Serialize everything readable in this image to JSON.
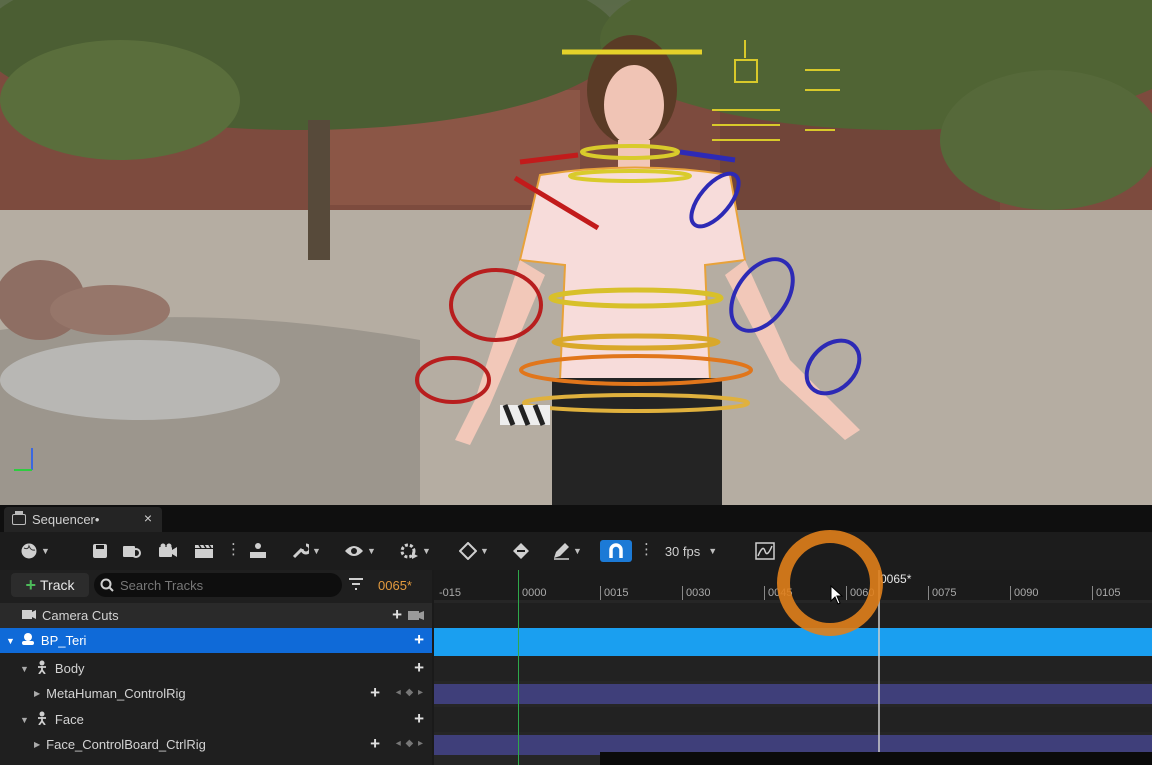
{
  "sequencer": {
    "tab_title": "Sequencer•",
    "close_glyph": "×",
    "toolbar": {
      "fps_label": "30 fps",
      "snap_active_color": "#1c7ad6"
    },
    "track_button_label": "Track",
    "search_placeholder": "Search Tracks",
    "current_frame": "0065*",
    "tracks": [
      {
        "label": "Camera Cuts",
        "icon": "camera-cuts-icon"
      },
      {
        "label": "BP_Teri",
        "icon": "actor-icon",
        "selected": true
      },
      {
        "label": "Body",
        "icon": "skeleton-icon"
      },
      {
        "label": "MetaHuman_ControlRig",
        "icon": "control-rig-icon"
      },
      {
        "label": "Face",
        "icon": "skeleton-icon"
      },
      {
        "label": "Face_ControlBoard_CtrlRig",
        "icon": "control-rig-icon"
      }
    ],
    "ruler_ticks": [
      "-015",
      "0000",
      "0015",
      "0030",
      "0045",
      "0060",
      "0075",
      "0090",
      "0105"
    ],
    "playhead_label": "0065*"
  },
  "colors": {
    "selection": "#0f6ad8",
    "section_blue": "#1a9ff0",
    "section_rig": "#3f3f7a",
    "highlight_ring": "#e0801b",
    "frame_orange": "#e39a3e"
  }
}
